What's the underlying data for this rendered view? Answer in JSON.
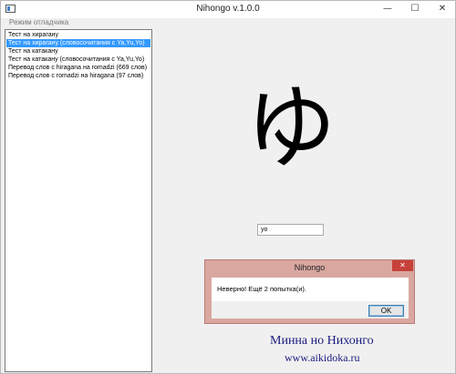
{
  "window": {
    "title": "Nihongo v.1.0.0",
    "controls": {
      "minimize": "—",
      "maximize": "☐",
      "close": "✕"
    }
  },
  "menu": {
    "debug_mode": "Режим отладчика"
  },
  "list": {
    "items": [
      "Тест на хирагану",
      "Тест на хирагану (словосочитания с Ya,Yu,Yo)",
      "Тест на катакану",
      "Тест на катакану (словосочитания с Ya,Yu,Yo)",
      "Перевод слов с hiragana на romadzi (669 слов)",
      "Перевод слов с romadzi на hiragana (97 слов)"
    ],
    "selected_index": 1
  },
  "quiz": {
    "character": "ゆ",
    "answer_value": "yo"
  },
  "dialog": {
    "title": "Nihongo",
    "close": "✕",
    "message": "Неверно! Ещё 2 попытка(и).",
    "ok_label": "OK"
  },
  "watermark": {
    "line1": "Минна но Нихонго",
    "line2": "www.aikidoka.ru"
  },
  "colors": {
    "selection": "#3399ff",
    "dialog_frame": "#d9a7a0",
    "close_button": "#c8403a",
    "watermark": "#1a1a7e"
  }
}
